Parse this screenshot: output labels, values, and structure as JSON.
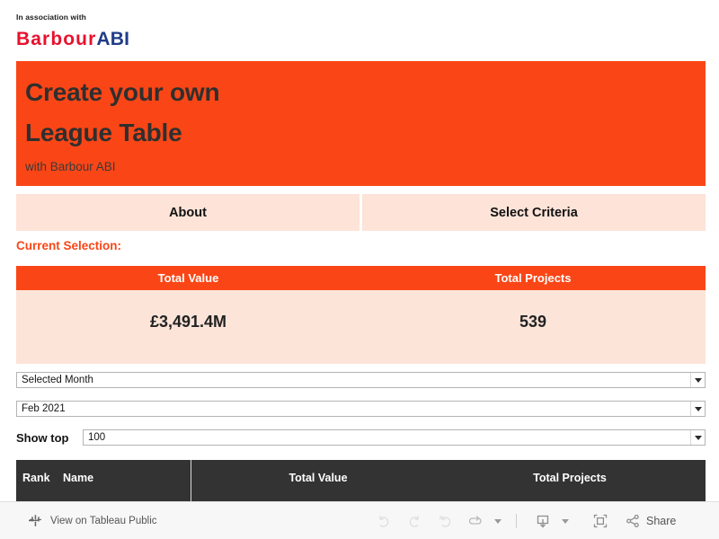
{
  "association": {
    "label": "In association with",
    "brand_first": "Barbour",
    "brand_second": "ABI",
    "brand_first_color": "#e8112d",
    "brand_second_color": "#1f3c88"
  },
  "hero": {
    "title_line1": "Create your own",
    "title_line2": "League Table",
    "subtitle": "with Barbour ABI",
    "background_color": "#fa4616",
    "text_color": "#2f2f2f"
  },
  "tabs": [
    {
      "label": "About",
      "selected": false
    },
    {
      "label": "Select Criteria",
      "selected": false
    }
  ],
  "current_selection": {
    "label": "Current Selection:",
    "color": "#fa4616"
  },
  "kpi": {
    "headers": [
      "Total Value",
      "Total Projects"
    ],
    "values": [
      "£3,491.4M",
      "539"
    ],
    "header_background": "#fa4616",
    "body_background": "#fce4d9"
  },
  "filters": [
    {
      "name": "selected-month-mode",
      "value": "Selected Month",
      "caret": "chevron-down-icon"
    },
    {
      "name": "selected-month-value",
      "value": "Feb 2021",
      "caret": "chevron-down-icon"
    },
    {
      "name": "show-top",
      "label": "Show top",
      "value": "100",
      "caret": "chevron-down-icon"
    }
  ],
  "table": {
    "headers": [
      "Rank",
      "Name",
      "Total Value",
      "Total Projects"
    ],
    "header_background": "#333333",
    "rows": []
  },
  "toolbar": {
    "view_label": "View on Tableau Public",
    "share_label": "Share",
    "buttons": [
      {
        "name": "undo-button",
        "icon": "undo-icon",
        "title": "Undo"
      },
      {
        "name": "redo-button",
        "icon": "redo-icon",
        "title": "Redo"
      },
      {
        "name": "revert-button",
        "icon": "revert-icon",
        "title": "Revert"
      },
      {
        "name": "refresh-button",
        "icon": "refresh-icon",
        "title": "Refresh"
      },
      {
        "name": "download-button",
        "icon": "download-icon",
        "title": "Download"
      },
      {
        "name": "fullscreen-button",
        "icon": "fullscreen-icon",
        "title": "Full Screen"
      },
      {
        "name": "share-button",
        "icon": "share-icon",
        "title": "Share"
      }
    ]
  }
}
